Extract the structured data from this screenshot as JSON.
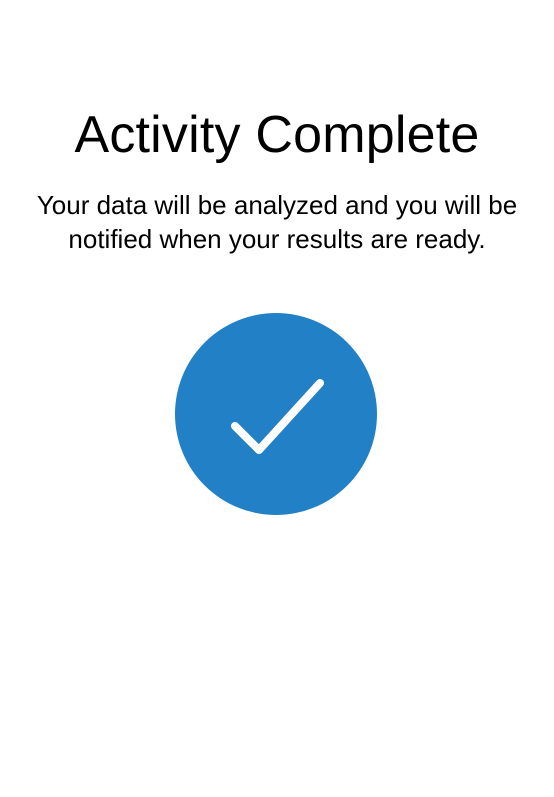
{
  "completion": {
    "title": "Activity Complete",
    "message_line1": "Your data will be analyzed and you will be",
    "message_line2": "notified when your results are ready.",
    "icon": "checkmark-icon",
    "accent_color": "#2280c7",
    "check_color": "#ffffff"
  }
}
